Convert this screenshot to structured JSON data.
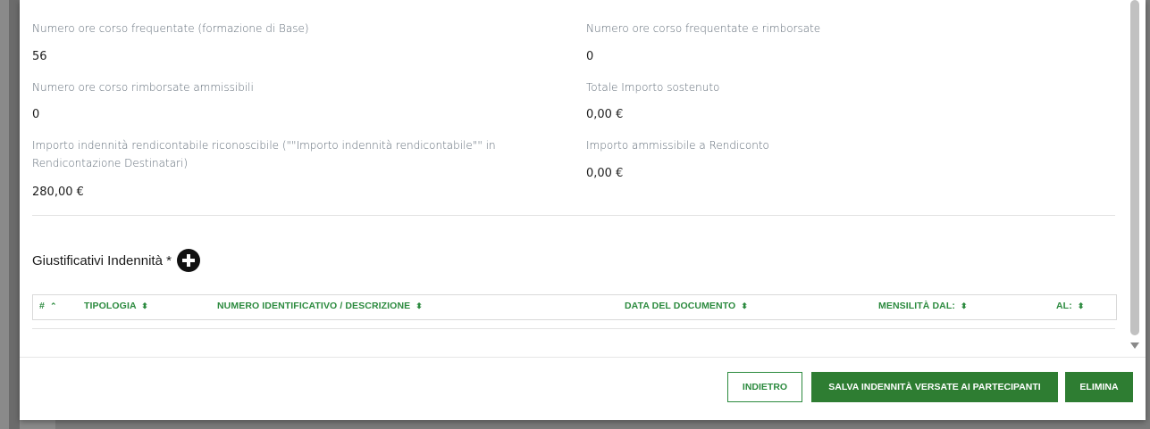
{
  "fields": {
    "ore_base_label": "Numero ore corso frequentate (formazione di Base)",
    "ore_base_value": "56",
    "ore_rimborsate_label": "Numero ore corso frequentate e rimborsate",
    "ore_rimborsate_value": "0",
    "ore_ammissibili_label": "Numero ore corso rimborsate ammissibili",
    "ore_ammissibili_value": "0",
    "totale_importo_label": "Totale Importo sostenuto",
    "totale_importo_value": "0,00 €",
    "indennita_label_line1": "Importo indennità rendicontabile riconoscibile (\"\"Importo indennità rendicontabile\"\" in",
    "indennita_label_line2": "Rendicontazione Destinatari)",
    "indennita_value": "280,00 €",
    "ammissibile_label": "Importo ammissibile a Rendiconto",
    "ammissibile_value": "0,00 €"
  },
  "section": {
    "title": "Giustificativi Indennità *",
    "add_icon": "plus-circle-icon"
  },
  "table": {
    "columns": [
      {
        "label": "#",
        "sort": "up"
      },
      {
        "label": "TIPOLOGIA",
        "sort": "both"
      },
      {
        "label": "NUMERO IDENTIFICATIVO / DESCRIZIONE",
        "sort": "both"
      },
      {
        "label": "DATA DEL DOCUMENTO",
        "sort": "both"
      },
      {
        "label": "MENSILITÀ DAL:",
        "sort": "both"
      },
      {
        "label": "AL:",
        "sort": "both"
      }
    ]
  },
  "footer": {
    "back_label": "INDIETRO",
    "save_label": "SALVA INDENNITÀ VERSATE AI PARTECIPANTI",
    "delete_label": "ELIMINA"
  },
  "colors": {
    "accent_green": "#2e7d32",
    "header_green": "#2b8a3e"
  }
}
